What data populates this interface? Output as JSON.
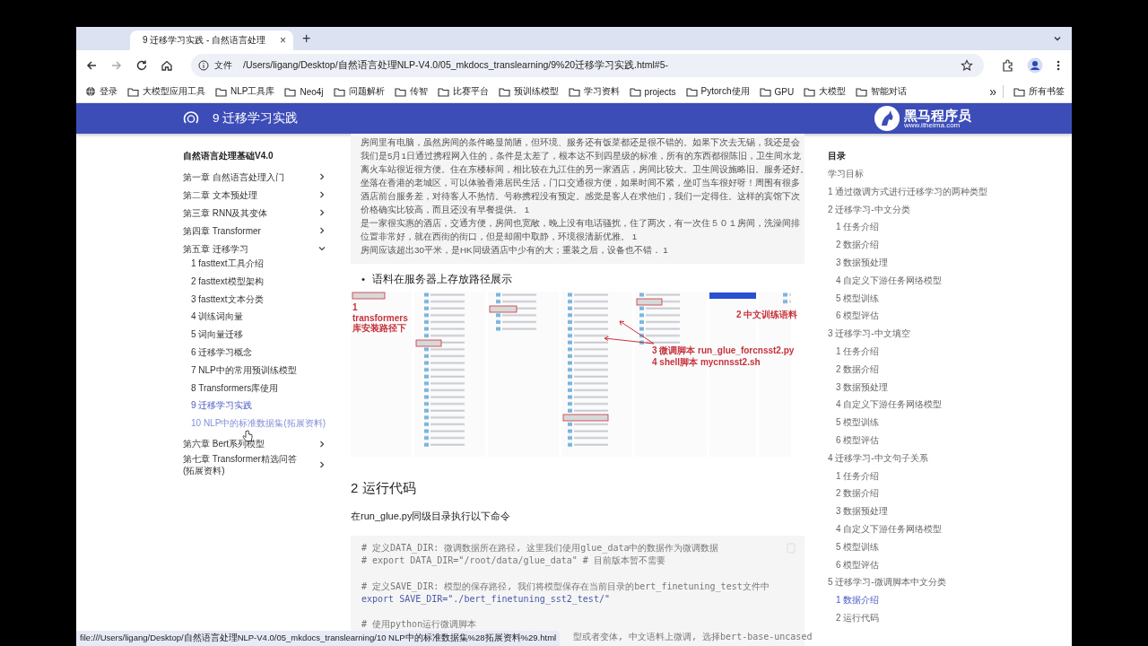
{
  "browser": {
    "tab": {
      "title": "9 迁移学习实践 - 自然语言处理",
      "close": "×"
    },
    "new_tab": "+",
    "address": {
      "chip": "文件",
      "url": "/Users/ligang/Desktop/自然语言处理NLP-V4.0/05_mkdocs_translearning/9%20迁移学习实践.html#5-"
    },
    "bookmarks": [
      {
        "label": "登录",
        "kind": "site"
      },
      {
        "label": "大模型应用工具",
        "kind": "folder"
      },
      {
        "label": "NLP工具库",
        "kind": "folder"
      },
      {
        "label": "Neo4j",
        "kind": "folder"
      },
      {
        "label": "问题解析",
        "kind": "folder"
      },
      {
        "label": "传智",
        "kind": "folder"
      },
      {
        "label": "比赛平台",
        "kind": "folder"
      },
      {
        "label": "预训练模型",
        "kind": "folder"
      },
      {
        "label": "学习资料",
        "kind": "folder"
      },
      {
        "label": "projects",
        "kind": "folder"
      },
      {
        "label": "Pytorch使用",
        "kind": "folder"
      },
      {
        "label": "GPU",
        "kind": "folder"
      },
      {
        "label": "大模型",
        "kind": "folder"
      },
      {
        "label": "智能对话",
        "kind": "folder"
      }
    ],
    "more": "»",
    "all_bookmarks": "所有书签",
    "status_bar": "file:///Users/ligang/Desktop/自然语言处理NLP-V4.0/05_mkdocs_translearning/10 NLP中的标准数据集%28拓展资料%29.html"
  },
  "header": {
    "title": "9 迁移学习实践",
    "brand": "黑马程序员",
    "brand_url": "www.itheima.com"
  },
  "sidebar": {
    "title": "自然语言处理基础V4.0",
    "items": [
      {
        "label": "第一章 自然语言处理入门",
        "expanded": false
      },
      {
        "label": "第二章 文本预处理",
        "expanded": false
      },
      {
        "label": "第三章 RNN及其变体",
        "expanded": false
      },
      {
        "label": "第四章 Transformer",
        "expanded": false
      },
      {
        "label": "第五章 迁移学习",
        "expanded": true,
        "children": [
          {
            "label": "1 fasttext工具介绍",
            "selected": false,
            "hovered": false
          },
          {
            "label": "2 fasttext模型架构",
            "selected": false,
            "hovered": false
          },
          {
            "label": "3 fasttext文本分类",
            "selected": false,
            "hovered": false
          },
          {
            "label": "4 训练词向量",
            "selected": false,
            "hovered": false
          },
          {
            "label": "5 词向量迁移",
            "selected": false,
            "hovered": false
          },
          {
            "label": "6 迁移学习概念",
            "selected": false,
            "hovered": false
          },
          {
            "label": "7 NLP中的常用预训练模型",
            "selected": false,
            "hovered": false
          },
          {
            "label": "8 Transformers库使用",
            "selected": false,
            "hovered": false
          },
          {
            "label": "9 迁移学习实践",
            "selected": true,
            "hovered": false
          },
          {
            "label": "10 NLP中的标准数据集(拓展资料)",
            "selected": false,
            "hovered": true
          }
        ]
      },
      {
        "label": "第六章 Bert系列模型",
        "expanded": false
      },
      {
        "label": "第七章 Transformer精选问答(拓展资料)",
        "expanded": false
      }
    ]
  },
  "content": {
    "sample_lines": [
      "房间里有电脑，虽然房间的条件略显简陋，但环境、服务还有饭菜都还是很不错的。如果下次去无锡，我还是会",
      "我们是5月1日通过携程网入住的，条件是太差了，根本达不到四星级的标准，所有的东西都很陈旧，卫生间水龙",
      "离火车站很近很方便。住在东楼标间，相比较在九江住的另一家酒店，房间比较大。卫生间设施略旧。服务还好。",
      "坐落在香港的老城区，可以体验香港居民生活，门口交通很方便，如果时间不紧，坐叮当车很好呀！周围有很多",
      "酒店前台服务差，对待客人不热情。号称携程没有预定。感觉是客人在求他们，我们一定得住。这样的宾馆下次",
      "价格确实比较高，而且还没有早餐提供。    1",
      "是一家很实惠的酒店，交通方便，房间也宽敞，晚上没有电话骚扰，住了两次，有一次住５０１房间，洗澡间排",
      "位置非常好，就在西街的街口，但是却闹中取静，环境很清新优雅。    1",
      "房间应该超出30平米，是HK同级酒店中少有的大；重装之后，设备也不错． 1"
    ],
    "bullet": {
      "marker": "•",
      "text": "语料在服务器上存放路径展示"
    },
    "figure": {
      "kind": "picture",
      "notes": [
        "1 transformers库安装路径下",
        "2 中文训练语料",
        "3 微调脚本 run_glue_forcnsst2.py",
        "4 shell脚本 mycnnsst2.sh"
      ]
    },
    "heading": "2 运行代码",
    "paragraph": "在run_glue.py同级目录执行以下命令",
    "code": [
      {
        "kind": "comment",
        "text": "# 定义DATA_DIR: 微调数据所在路径, 这里我们使用glue_data中的数据作为微调数据"
      },
      {
        "kind": "comment",
        "text": "# export DATA_DIR=\"/root/data/glue_data\" # 目前版本暂不需要"
      },
      {
        "kind": "blank"
      },
      {
        "kind": "comment",
        "text": "# 定义SAVE_DIR: 模型的保存路径, 我们将模型保存在当前目录的bert_finetuning_test文件中"
      },
      {
        "kind": "code",
        "text": "export SAVE_DIR=\"./bert_finetuning_sst2_test/\""
      },
      {
        "kind": "blank"
      },
      {
        "kind": "comment",
        "text": "# 使用python运行微调脚本"
      },
      {
        "kind": "covered",
        "text": "型或者变体, 中文语料上微调, 选择bert-base-uncased"
      }
    ]
  },
  "toc": {
    "title": "目录",
    "items": [
      {
        "label": "学习目标",
        "selected": false
      },
      {
        "label": "1 通过微调方式进行迁移学习的两种类型",
        "selected": false
      },
      {
        "label": "2 迁移学习-中文分类",
        "selected": false,
        "children": [
          {
            "label": "1 任务介绍",
            "selected": false
          },
          {
            "label": "2 数据介绍",
            "selected": false
          },
          {
            "label": "3 数据预处理",
            "selected": false
          },
          {
            "label": "4 自定义下游任务网络模型",
            "selected": false
          },
          {
            "label": "5 模型训练",
            "selected": false
          },
          {
            "label": "6 模型评估",
            "selected": false
          }
        ]
      },
      {
        "label": "3 迁移学习-中文填空",
        "selected": false,
        "children": [
          {
            "label": "1 任务介绍",
            "selected": false
          },
          {
            "label": "2 数据介绍",
            "selected": false
          },
          {
            "label": "3 数据预处理",
            "selected": false
          },
          {
            "label": "4 自定义下游任务网络模型",
            "selected": false
          },
          {
            "label": "5 模型训练",
            "selected": false
          },
          {
            "label": "6 模型评估",
            "selected": false
          }
        ]
      },
      {
        "label": "4 迁移学习-中文句子关系",
        "selected": false,
        "children": [
          {
            "label": "1 任务介绍",
            "selected": false
          },
          {
            "label": "2 数据介绍",
            "selected": false
          },
          {
            "label": "3 数据预处理",
            "selected": false
          },
          {
            "label": "4 自定义下游任务网络模型",
            "selected": false
          },
          {
            "label": "5 模型训练",
            "selected": false
          },
          {
            "label": "6 模型评估",
            "selected": false
          }
        ]
      },
      {
        "label": "5 迁移学习-微调脚本中文分类",
        "selected": false,
        "children": [
          {
            "label": "1 数据介绍",
            "selected": true
          },
          {
            "label": "2 运行代码",
            "selected": false
          }
        ]
      }
    ]
  }
}
